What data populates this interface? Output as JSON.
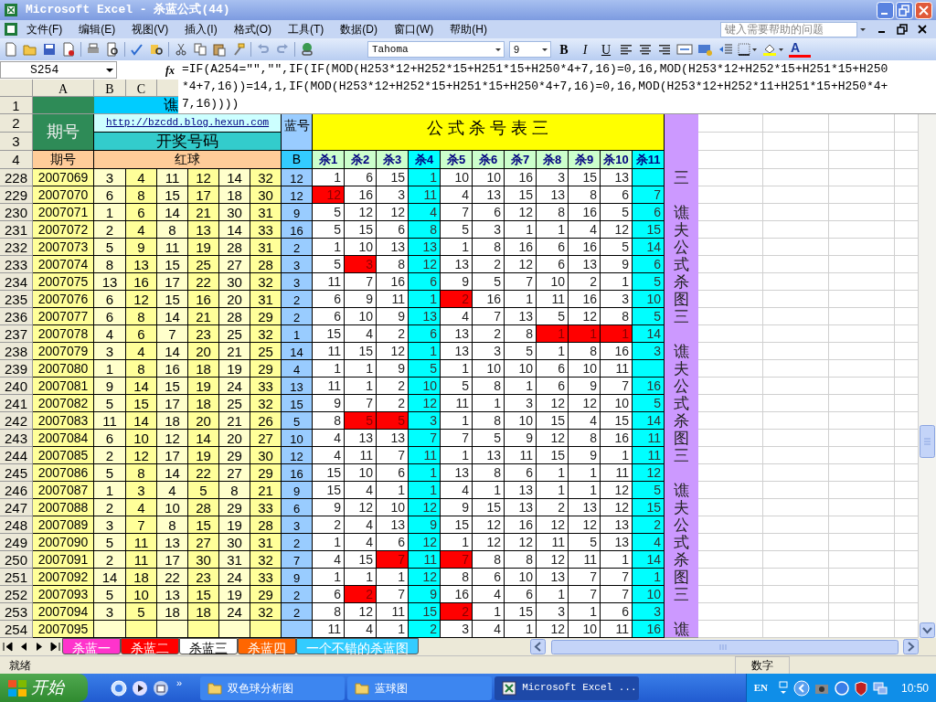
{
  "window": {
    "title": "Microsoft Excel - 杀蓝公式(44)"
  },
  "menu": [
    "文件(F)",
    "编辑(E)",
    "视图(V)",
    "插入(I)",
    "格式(O)",
    "工具(T)",
    "数据(D)",
    "窗口(W)",
    "帮助(H)"
  ],
  "help_box": {
    "placeholder": "键入需要帮助的问题"
  },
  "formatting": {
    "font": "Tahoma",
    "size": "9",
    "bold": "B",
    "italic": "I",
    "underline": "U",
    "font_color": "A"
  },
  "formula_bar": {
    "cell": "S254",
    "fx": "fx",
    "formula": "=IF(A254=\"\",\"\",IF(IF(MOD(H253*12+H252*15+H251*15+H250*4+7,16)=0,16,MOD(H253*12+H252*15+H251*15+H250*4+7,16))=14,1,IF(MOD(H253*12+H252*15+H251*15+H250*4+7,16)=0,16,MOD(H253*12+H252*11+H251*15+H250*4+7,16))))"
  },
  "column_headers": [
    "A",
    "B",
    "C"
  ],
  "row_numbers": [
    "1",
    "2",
    "3",
    "4"
  ],
  "sheet": {
    "title_cell": "谯",
    "period_header": "期号",
    "link": "http://bzcdd.blog.hexun.com",
    "draw_numbers": "开奖号码",
    "blue_header": "蓝号",
    "kill_title": "公 式 杀 号 表 三",
    "period_label": "期号",
    "red_label": "红球",
    "blue_label": "B",
    "kill_columns": [
      {
        "label": "杀1",
        "highlighted": false
      },
      {
        "label": "杀2",
        "highlighted": false
      },
      {
        "label": "杀3",
        "highlighted": false
      },
      {
        "label": "杀4",
        "highlighted": true
      },
      {
        "label": "杀5",
        "highlighted": false
      },
      {
        "label": "杀6",
        "highlighted": false
      },
      {
        "label": "杀7",
        "highlighted": false
      },
      {
        "label": "杀8",
        "highlighted": false
      },
      {
        "label": "杀9",
        "highlighted": false
      },
      {
        "label": "杀10",
        "highlighted": false
      },
      {
        "label": "杀11",
        "highlighted": true
      }
    ]
  },
  "rows": [
    {
      "row": "228",
      "period": "2007069",
      "red": [
        "3",
        "4",
        "11",
        "12",
        "14",
        "32"
      ],
      "blue": "12",
      "kills": [
        {
          "value": "1",
          "hit": false
        },
        {
          "value": "6",
          "hit": false
        },
        {
          "value": "15",
          "hit": false
        },
        {
          "value": "1",
          "hit": false
        },
        {
          "value": "10",
          "hit": false
        },
        {
          "value": "10",
          "hit": false
        },
        {
          "value": "16",
          "hit": false
        },
        {
          "value": "3",
          "hit": false
        },
        {
          "value": "15",
          "hit": false
        },
        {
          "value": "13",
          "hit": false
        },
        {
          "hit": false
        }
      ]
    },
    {
      "row": "229",
      "period": "2007070",
      "red": [
        "6",
        "8",
        "15",
        "17",
        "18",
        "30"
      ],
      "blue": "12",
      "kills": [
        {
          "value": "12",
          "hit": true
        },
        {
          "value": "16",
          "hit": false
        },
        {
          "value": "3",
          "hit": false
        },
        {
          "value": "11",
          "hit": false
        },
        {
          "value": "4",
          "hit": false
        },
        {
          "value": "13",
          "hit": false
        },
        {
          "value": "15",
          "hit": false
        },
        {
          "value": "13",
          "hit": false
        },
        {
          "value": "8",
          "hit": false
        },
        {
          "value": "6",
          "hit": false
        },
        {
          "value": "7",
          "hit": false
        }
      ]
    },
    {
      "row": "230",
      "period": "2007071",
      "red": [
        "1",
        "6",
        "14",
        "21",
        "30",
        "31"
      ],
      "blue": "9",
      "kills": [
        {
          "value": "5",
          "hit": false
        },
        {
          "value": "12",
          "hit": false
        },
        {
          "value": "12",
          "hit": false
        },
        {
          "value": "4",
          "hit": false
        },
        {
          "value": "7",
          "hit": false
        },
        {
          "value": "6",
          "hit": false
        },
        {
          "value": "12",
          "hit": false
        },
        {
          "value": "8",
          "hit": false
        },
        {
          "value": "16",
          "hit": false
        },
        {
          "value": "5",
          "hit": false
        },
        {
          "value": "6",
          "hit": false
        }
      ]
    },
    {
      "row": "231",
      "period": "2007072",
      "red": [
        "2",
        "4",
        "8",
        "13",
        "14",
        "33"
      ],
      "blue": "16",
      "kills": [
        {
          "value": "5",
          "hit": false
        },
        {
          "value": "15",
          "hit": false
        },
        {
          "value": "6",
          "hit": false
        },
        {
          "value": "8",
          "hit": false
        },
        {
          "value": "5",
          "hit": false
        },
        {
          "value": "3",
          "hit": false
        },
        {
          "value": "1",
          "hit": false
        },
        {
          "value": "1",
          "hit": false
        },
        {
          "value": "4",
          "hit": false
        },
        {
          "value": "12",
          "hit": false
        },
        {
          "value": "15",
          "hit": false
        }
      ]
    },
    {
      "row": "232",
      "period": "2007073",
      "red": [
        "5",
        "9",
        "11",
        "19",
        "28",
        "31"
      ],
      "blue": "2",
      "kills": [
        {
          "value": "1",
          "hit": false
        },
        {
          "value": "10",
          "hit": false
        },
        {
          "value": "13",
          "hit": false
        },
        {
          "value": "13",
          "hit": false
        },
        {
          "value": "1",
          "hit": false
        },
        {
          "value": "8",
          "hit": false
        },
        {
          "value": "16",
          "hit": false
        },
        {
          "value": "6",
          "hit": false
        },
        {
          "value": "16",
          "hit": false
        },
        {
          "value": "5",
          "hit": false
        },
        {
          "value": "14",
          "hit": false
        }
      ]
    },
    {
      "row": "233",
      "period": "2007074",
      "red": [
        "8",
        "13",
        "15",
        "25",
        "27",
        "28"
      ],
      "blue": "3",
      "kills": [
        {
          "value": "5",
          "hit": false
        },
        {
          "value": "3",
          "hit": true
        },
        {
          "value": "8",
          "hit": false
        },
        {
          "value": "12",
          "hit": false
        },
        {
          "value": "13",
          "hit": false
        },
        {
          "value": "2",
          "hit": false
        },
        {
          "value": "12",
          "hit": false
        },
        {
          "value": "6",
          "hit": false
        },
        {
          "value": "13",
          "hit": false
        },
        {
          "value": "9",
          "hit": false
        },
        {
          "value": "6",
          "hit": false
        }
      ]
    },
    {
      "row": "234",
      "period": "2007075",
      "red": [
        "13",
        "16",
        "17",
        "22",
        "30",
        "32"
      ],
      "blue": "3",
      "kills": [
        {
          "value": "11",
          "hit": false
        },
        {
          "value": "7",
          "hit": false
        },
        {
          "value": "16",
          "hit": false
        },
        {
          "value": "6",
          "hit": false
        },
        {
          "value": "9",
          "hit": false
        },
        {
          "value": "5",
          "hit": false
        },
        {
          "value": "7",
          "hit": false
        },
        {
          "value": "10",
          "hit": false
        },
        {
          "value": "2",
          "hit": false
        },
        {
          "value": "1",
          "hit": false
        },
        {
          "value": "5",
          "hit": false
        }
      ]
    },
    {
      "row": "235",
      "period": "2007076",
      "red": [
        "6",
        "12",
        "15",
        "16",
        "20",
        "31"
      ],
      "blue": "2",
      "kills": [
        {
          "value": "6",
          "hit": false
        },
        {
          "value": "9",
          "hit": false
        },
        {
          "value": "11",
          "hit": false
        },
        {
          "value": "1",
          "hit": false
        },
        {
          "value": "2",
          "hit": true
        },
        {
          "value": "16",
          "hit": false
        },
        {
          "value": "1",
          "hit": false
        },
        {
          "value": "11",
          "hit": false
        },
        {
          "value": "16",
          "hit": false
        },
        {
          "value": "3",
          "hit": false
        },
        {
          "value": "10",
          "hit": false
        }
      ]
    },
    {
      "row": "236",
      "period": "2007077",
      "red": [
        "6",
        "8",
        "14",
        "21",
        "28",
        "29"
      ],
      "blue": "2",
      "kills": [
        {
          "value": "6",
          "hit": false
        },
        {
          "value": "10",
          "hit": false
        },
        {
          "value": "9",
          "hit": false
        },
        {
          "value": "13",
          "hit": false
        },
        {
          "value": "4",
          "hit": false
        },
        {
          "value": "7",
          "hit": false
        },
        {
          "value": "13",
          "hit": false
        },
        {
          "value": "5",
          "hit": false
        },
        {
          "value": "12",
          "hit": false
        },
        {
          "value": "8",
          "hit": false
        },
        {
          "value": "5",
          "hit": false
        }
      ]
    },
    {
      "row": "237",
      "period": "2007078",
      "red": [
        "4",
        "6",
        "7",
        "23",
        "25",
        "32"
      ],
      "blue": "1",
      "kills": [
        {
          "value": "15",
          "hit": false
        },
        {
          "value": "4",
          "hit": false
        },
        {
          "value": "2",
          "hit": false
        },
        {
          "value": "6",
          "hit": false
        },
        {
          "value": "13",
          "hit": false
        },
        {
          "value": "2",
          "hit": false
        },
        {
          "value": "8",
          "hit": false
        },
        {
          "value": "1",
          "hit": true
        },
        {
          "value": "1",
          "hit": true
        },
        {
          "value": "1",
          "hit": true
        },
        {
          "value": "14",
          "hit": false
        }
      ]
    },
    {
      "row": "238",
      "period": "2007079",
      "red": [
        "3",
        "4",
        "14",
        "20",
        "21",
        "25"
      ],
      "blue": "14",
      "kills": [
        {
          "value": "11",
          "hit": false
        },
        {
          "value": "15",
          "hit": false
        },
        {
          "value": "12",
          "hit": false
        },
        {
          "value": "1",
          "hit": false
        },
        {
          "value": "13",
          "hit": false
        },
        {
          "value": "3",
          "hit": false
        },
        {
          "value": "5",
          "hit": false
        },
        {
          "value": "1",
          "hit": false
        },
        {
          "value": "8",
          "hit": false
        },
        {
          "value": "16",
          "hit": false
        },
        {
          "value": "3",
          "hit": false
        }
      ]
    },
    {
      "row": "239",
      "period": "2007080",
      "red": [
        "1",
        "8",
        "16",
        "18",
        "19",
        "29"
      ],
      "blue": "4",
      "kills": [
        {
          "value": "1",
          "hit": false
        },
        {
          "value": "1",
          "hit": false
        },
        {
          "value": "9",
          "hit": false
        },
        {
          "value": "5",
          "hit": false
        },
        {
          "value": "1",
          "hit": false
        },
        {
          "value": "10",
          "hit": false
        },
        {
          "value": "10",
          "hit": false
        },
        {
          "value": "6",
          "hit": false
        },
        {
          "value": "10",
          "hit": false
        },
        {
          "value": "11",
          "hit": false
        },
        {
          "hit": false
        }
      ]
    },
    {
      "row": "240",
      "period": "2007081",
      "red": [
        "9",
        "14",
        "15",
        "19",
        "24",
        "33"
      ],
      "blue": "13",
      "kills": [
        {
          "value": "11",
          "hit": false
        },
        {
          "value": "1",
          "hit": false
        },
        {
          "value": "2",
          "hit": false
        },
        {
          "value": "10",
          "hit": false
        },
        {
          "value": "5",
          "hit": false
        },
        {
          "value": "8",
          "hit": false
        },
        {
          "value": "1",
          "hit": false
        },
        {
          "value": "6",
          "hit": false
        },
        {
          "value": "9",
          "hit": false
        },
        {
          "value": "7",
          "hit": false
        },
        {
          "value": "16",
          "hit": false
        }
      ]
    },
    {
      "row": "241",
      "period": "2007082",
      "red": [
        "5",
        "15",
        "17",
        "18",
        "25",
        "32"
      ],
      "blue": "15",
      "kills": [
        {
          "value": "9",
          "hit": false
        },
        {
          "value": "7",
          "hit": false
        },
        {
          "value": "2",
          "hit": false
        },
        {
          "value": "12",
          "hit": false
        },
        {
          "value": "11",
          "hit": false
        },
        {
          "value": "1",
          "hit": false
        },
        {
          "value": "3",
          "hit": false
        },
        {
          "value": "12",
          "hit": false
        },
        {
          "value": "12",
          "hit": false
        },
        {
          "value": "10",
          "hit": false
        },
        {
          "value": "5",
          "hit": false
        }
      ]
    },
    {
      "row": "242",
      "period": "2007083",
      "red": [
        "11",
        "14",
        "18",
        "20",
        "21",
        "26"
      ],
      "blue": "5",
      "kills": [
        {
          "value": "8",
          "hit": false
        },
        {
          "value": "5",
          "hit": true
        },
        {
          "value": "5",
          "hit": true
        },
        {
          "value": "3",
          "hit": false
        },
        {
          "value": "1",
          "hit": false
        },
        {
          "value": "8",
          "hit": false
        },
        {
          "value": "10",
          "hit": false
        },
        {
          "value": "15",
          "hit": false
        },
        {
          "value": "4",
          "hit": false
        },
        {
          "value": "15",
          "hit": false
        },
        {
          "value": "14",
          "hit": false
        }
      ]
    },
    {
      "row": "243",
      "period": "2007084",
      "red": [
        "6",
        "10",
        "12",
        "14",
        "20",
        "27"
      ],
      "blue": "10",
      "kills": [
        {
          "value": "4",
          "hit": false
        },
        {
          "value": "13",
          "hit": false
        },
        {
          "value": "13",
          "hit": false
        },
        {
          "value": "7",
          "hit": false
        },
        {
          "value": "7",
          "hit": false
        },
        {
          "value": "5",
          "hit": false
        },
        {
          "value": "9",
          "hit": false
        },
        {
          "value": "12",
          "hit": false
        },
        {
          "value": "8",
          "hit": false
        },
        {
          "value": "16",
          "hit": false
        },
        {
          "value": "11",
          "hit": false
        }
      ]
    },
    {
      "row": "244",
      "period": "2007085",
      "red": [
        "2",
        "12",
        "17",
        "19",
        "29",
        "30"
      ],
      "blue": "12",
      "kills": [
        {
          "value": "4",
          "hit": false
        },
        {
          "value": "11",
          "hit": false
        },
        {
          "value": "7",
          "hit": false
        },
        {
          "value": "11",
          "hit": false
        },
        {
          "value": "1",
          "hit": false
        },
        {
          "value": "13",
          "hit": false
        },
        {
          "value": "11",
          "hit": false
        },
        {
          "value": "15",
          "hit": false
        },
        {
          "value": "9",
          "hit": false
        },
        {
          "value": "1",
          "hit": false
        },
        {
          "value": "11",
          "hit": false
        }
      ]
    },
    {
      "row": "245",
      "period": "2007086",
      "red": [
        "5",
        "8",
        "14",
        "22",
        "27",
        "29"
      ],
      "blue": "16",
      "kills": [
        {
          "value": "15",
          "hit": false
        },
        {
          "value": "10",
          "hit": false
        },
        {
          "value": "6",
          "hit": false
        },
        {
          "value": "1",
          "hit": false
        },
        {
          "value": "13",
          "hit": false
        },
        {
          "value": "8",
          "hit": false
        },
        {
          "value": "6",
          "hit": false
        },
        {
          "value": "1",
          "hit": false
        },
        {
          "value": "1",
          "hit": false
        },
        {
          "value": "11",
          "hit": false
        },
        {
          "value": "12",
          "hit": false
        }
      ]
    },
    {
      "row": "246",
      "period": "2007087",
      "red": [
        "1",
        "3",
        "4",
        "5",
        "8",
        "21"
      ],
      "blue": "9",
      "kills": [
        {
          "value": "15",
          "hit": false
        },
        {
          "value": "4",
          "hit": false
        },
        {
          "value": "1",
          "hit": false
        },
        {
          "value": "1",
          "hit": false
        },
        {
          "value": "4",
          "hit": false
        },
        {
          "value": "1",
          "hit": false
        },
        {
          "value": "13",
          "hit": false
        },
        {
          "value": "1",
          "hit": false
        },
        {
          "value": "1",
          "hit": false
        },
        {
          "value": "12",
          "hit": false
        },
        {
          "value": "5",
          "hit": false
        }
      ]
    },
    {
      "row": "247",
      "period": "2007088",
      "red": [
        "2",
        "4",
        "10",
        "28",
        "29",
        "33"
      ],
      "blue": "6",
      "kills": [
        {
          "value": "9",
          "hit": false
        },
        {
          "value": "12",
          "hit": false
        },
        {
          "value": "10",
          "hit": false
        },
        {
          "value": "12",
          "hit": false
        },
        {
          "value": "9",
          "hit": false
        },
        {
          "value": "15",
          "hit": false
        },
        {
          "value": "13",
          "hit": false
        },
        {
          "value": "2",
          "hit": false
        },
        {
          "value": "13",
          "hit": false
        },
        {
          "value": "12",
          "hit": false
        },
        {
          "value": "15",
          "hit": false
        }
      ]
    },
    {
      "row": "248",
      "period": "2007089",
      "red": [
        "3",
        "7",
        "8",
        "15",
        "19",
        "28"
      ],
      "blue": "3",
      "kills": [
        {
          "value": "2",
          "hit": false
        },
        {
          "value": "4",
          "hit": false
        },
        {
          "value": "13",
          "hit": false
        },
        {
          "value": "9",
          "hit": false
        },
        {
          "value": "15",
          "hit": false
        },
        {
          "value": "12",
          "hit": false
        },
        {
          "value": "16",
          "hit": false
        },
        {
          "value": "12",
          "hit": false
        },
        {
          "value": "12",
          "hit": false
        },
        {
          "value": "13",
          "hit": false
        },
        {
          "value": "2",
          "hit": false
        }
      ]
    },
    {
      "row": "249",
      "period": "2007090",
      "red": [
        "5",
        "11",
        "13",
        "27",
        "30",
        "31"
      ],
      "blue": "2",
      "kills": [
        {
          "value": "1",
          "hit": false
        },
        {
          "value": "4",
          "hit": false
        },
        {
          "value": "6",
          "hit": false
        },
        {
          "value": "12",
          "hit": false
        },
        {
          "value": "1",
          "hit": false
        },
        {
          "value": "12",
          "hit": false
        },
        {
          "value": "12",
          "hit": false
        },
        {
          "value": "11",
          "hit": false
        },
        {
          "value": "5",
          "hit": false
        },
        {
          "value": "13",
          "hit": false
        },
        {
          "value": "4",
          "hit": false
        }
      ]
    },
    {
      "row": "250",
      "period": "2007091",
      "red": [
        "2",
        "11",
        "17",
        "30",
        "31",
        "32"
      ],
      "blue": "7",
      "kills": [
        {
          "value": "4",
          "hit": false
        },
        {
          "value": "15",
          "hit": false
        },
        {
          "value": "7",
          "hit": true
        },
        {
          "value": "11",
          "hit": false
        },
        {
          "value": "7",
          "hit": true
        },
        {
          "value": "8",
          "hit": false
        },
        {
          "value": "8",
          "hit": false
        },
        {
          "value": "12",
          "hit": false
        },
        {
          "value": "11",
          "hit": false
        },
        {
          "value": "1",
          "hit": false
        },
        {
          "value": "14",
          "hit": false
        }
      ]
    },
    {
      "row": "251",
      "period": "2007092",
      "red": [
        "14",
        "18",
        "22",
        "23",
        "24",
        "33"
      ],
      "blue": "9",
      "kills": [
        {
          "value": "1",
          "hit": false
        },
        {
          "value": "1",
          "hit": false
        },
        {
          "value": "1",
          "hit": false
        },
        {
          "value": "12",
          "hit": false
        },
        {
          "value": "8",
          "hit": false
        },
        {
          "value": "6",
          "hit": false
        },
        {
          "value": "10",
          "hit": false
        },
        {
          "value": "13",
          "hit": false
        },
        {
          "value": "7",
          "hit": false
        },
        {
          "value": "7",
          "hit": false
        },
        {
          "value": "1",
          "hit": false
        }
      ]
    },
    {
      "row": "252",
      "period": "2007093",
      "red": [
        "5",
        "10",
        "13",
        "15",
        "19",
        "29"
      ],
      "blue": "2",
      "kills": [
        {
          "value": "6",
          "hit": false
        },
        {
          "value": "2",
          "hit": true
        },
        {
          "value": "7",
          "hit": false
        },
        {
          "value": "9",
          "hit": false
        },
        {
          "value": "16",
          "hit": false
        },
        {
          "value": "4",
          "hit": false
        },
        {
          "value": "6",
          "hit": false
        },
        {
          "value": "1",
          "hit": false
        },
        {
          "value": "7",
          "hit": false
        },
        {
          "value": "7",
          "hit": false
        },
        {
          "value": "10",
          "hit": false
        }
      ]
    },
    {
      "row": "253",
      "period": "2007094",
      "red": [
        "3",
        "5",
        "18",
        "18",
        "24",
        "32"
      ],
      "blue": "2",
      "kills": [
        {
          "value": "8",
          "hit": false
        },
        {
          "value": "12",
          "hit": false
        },
        {
          "value": "11",
          "hit": false
        },
        {
          "value": "15",
          "hit": false
        },
        {
          "value": "2",
          "hit": true
        },
        {
          "value": "1",
          "hit": false
        },
        {
          "value": "15",
          "hit": false
        },
        {
          "value": "3",
          "hit": false
        },
        {
          "value": "1",
          "hit": false
        },
        {
          "value": "6",
          "hit": false
        },
        {
          "value": "3",
          "hit": false
        }
      ]
    },
    {
      "row": "254",
      "period": "2007095",
      "kills": [
        {
          "value": "11",
          "hit": false
        },
        {
          "value": "4",
          "hit": false
        },
        {
          "value": "1",
          "hit": false
        },
        {
          "value": "2",
          "hit": false
        },
        {
          "value": "3",
          "hit": false
        },
        {
          "value": "4",
          "hit": false
        },
        {
          "value": "1",
          "hit": false
        },
        {
          "value": "12",
          "hit": false
        },
        {
          "value": "10",
          "hit": false
        },
        {
          "value": "11",
          "hit": false
        },
        {
          "value": "16",
          "hit": false
        }
      ]
    }
  ],
  "side_banner": [
    "三",
    "谯夫公式杀图三",
    "谯夫公式杀图三",
    "谯夫公式杀图三",
    "谯"
  ],
  "sheet_tabs": [
    {
      "label": "杀蓝一",
      "color": "#ff33cc",
      "selected": false
    },
    {
      "label": "杀蓝二",
      "color": "#ff0000",
      "selected": false
    },
    {
      "label": "杀蓝三",
      "color": "#ffffff",
      "selected": true
    },
    {
      "label": "杀蓝四",
      "color": "#ff6600",
      "selected": false
    },
    {
      "label": "一个不错的杀蓝图",
      "color": "#33ccff",
      "selected": false
    }
  ],
  "status_bar": {
    "left": "就绪",
    "right": "数字"
  },
  "taskbar": {
    "start": "开始",
    "more": "»",
    "tasks": [
      {
        "label": "双色球分析图",
        "kind": "folder",
        "selected": false
      },
      {
        "label": "蓝球图",
        "kind": "folder",
        "selected": false
      },
      {
        "label": "Microsoft Excel ...",
        "kind": "excel",
        "selected": true
      }
    ],
    "language": "EN",
    "time": "10:50"
  }
}
